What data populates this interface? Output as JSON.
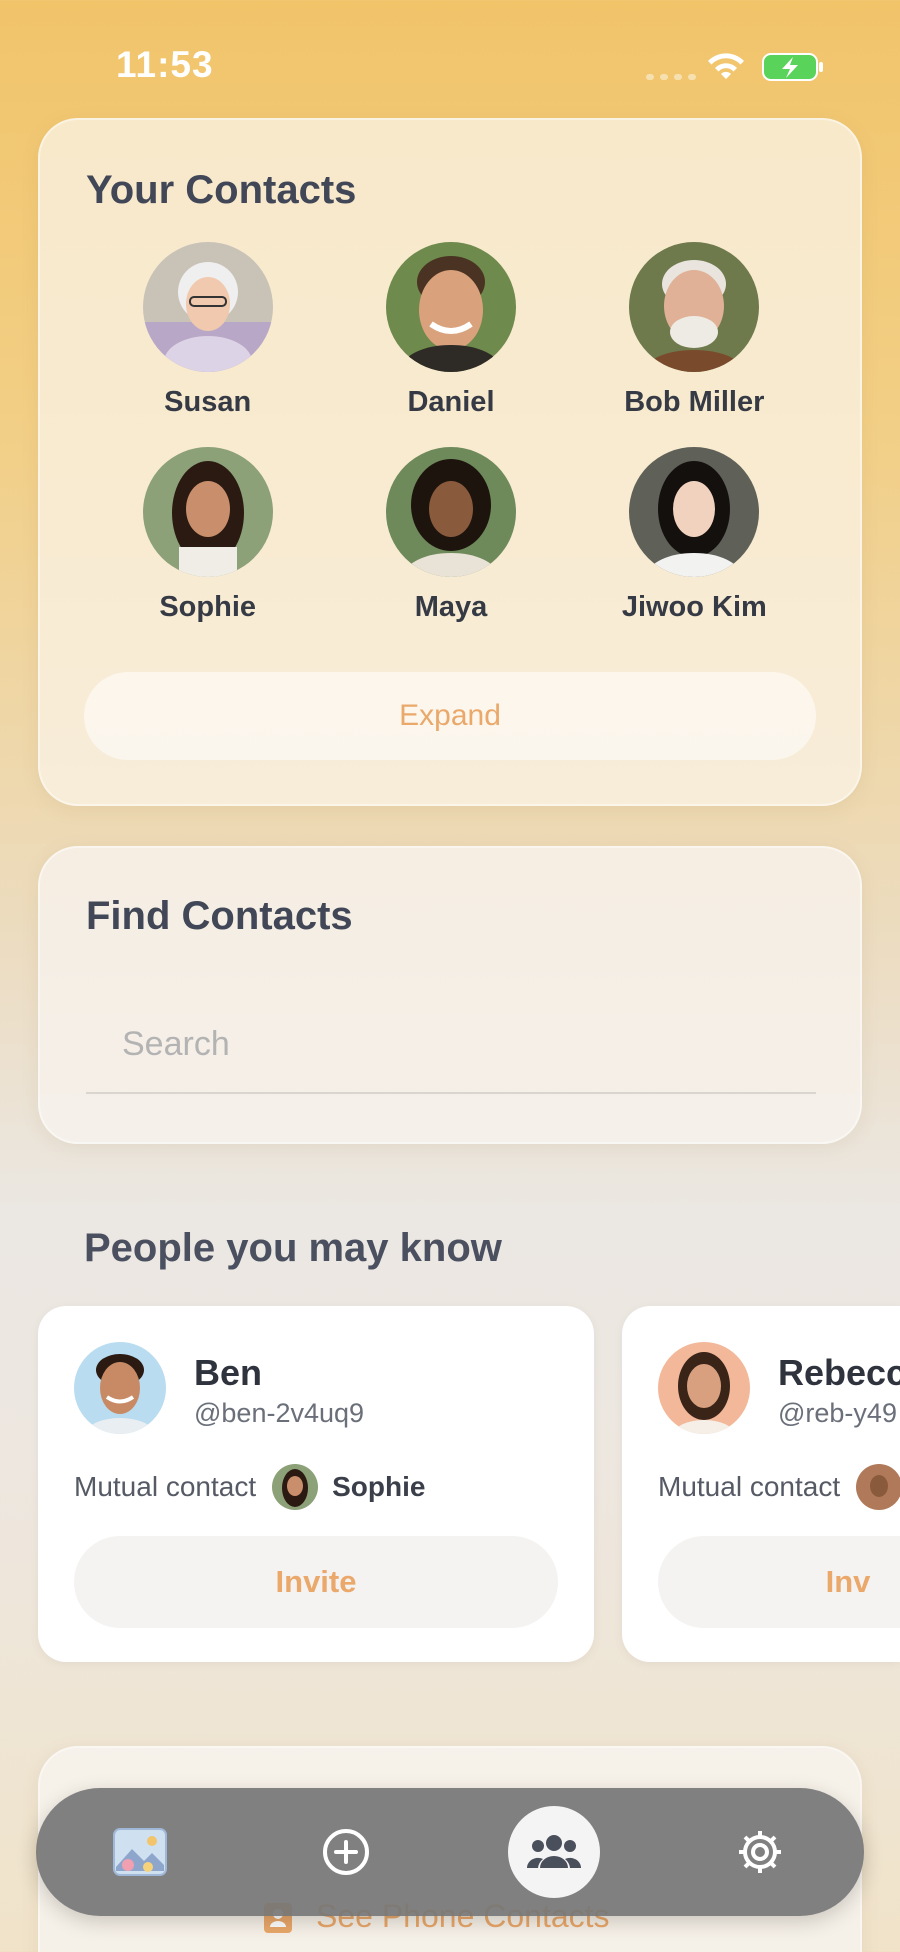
{
  "status_bar": {
    "time": "11:53"
  },
  "your_contacts": {
    "title": "Your Contacts",
    "contacts": [
      {
        "name": "Susan"
      },
      {
        "name": "Daniel"
      },
      {
        "name": "Bob Miller"
      },
      {
        "name": "Sophie"
      },
      {
        "name": "Maya"
      },
      {
        "name": "Jiwoo Kim"
      }
    ],
    "expand_label": "Expand"
  },
  "find_contacts": {
    "title": "Find Contacts",
    "search_placeholder": "Search",
    "search_value": ""
  },
  "people_you_may_know": {
    "title": "People you may know",
    "suggestions": [
      {
        "name": "Ben",
        "handle": "@ben-2v4uq9",
        "mutual_label": "Mutual contact",
        "mutual_name": "Sophie",
        "invite_label": "Invite"
      },
      {
        "name": "Rebecc",
        "handle": "@reb-y49",
        "mutual_label": "Mutual contact",
        "mutual_name": "",
        "invite_label": "Inv"
      }
    ]
  },
  "phone_contacts": {
    "label": "See Phone Contacts"
  },
  "tab_bar": {
    "tabs": [
      {
        "icon": "photos-icon"
      },
      {
        "icon": "add-circle-icon"
      },
      {
        "icon": "people-icon",
        "active": true
      },
      {
        "icon": "gear-icon"
      }
    ]
  },
  "colors": {
    "accent": "#eaa86a",
    "title_text": "#414756",
    "tab_bar": "#767676"
  }
}
